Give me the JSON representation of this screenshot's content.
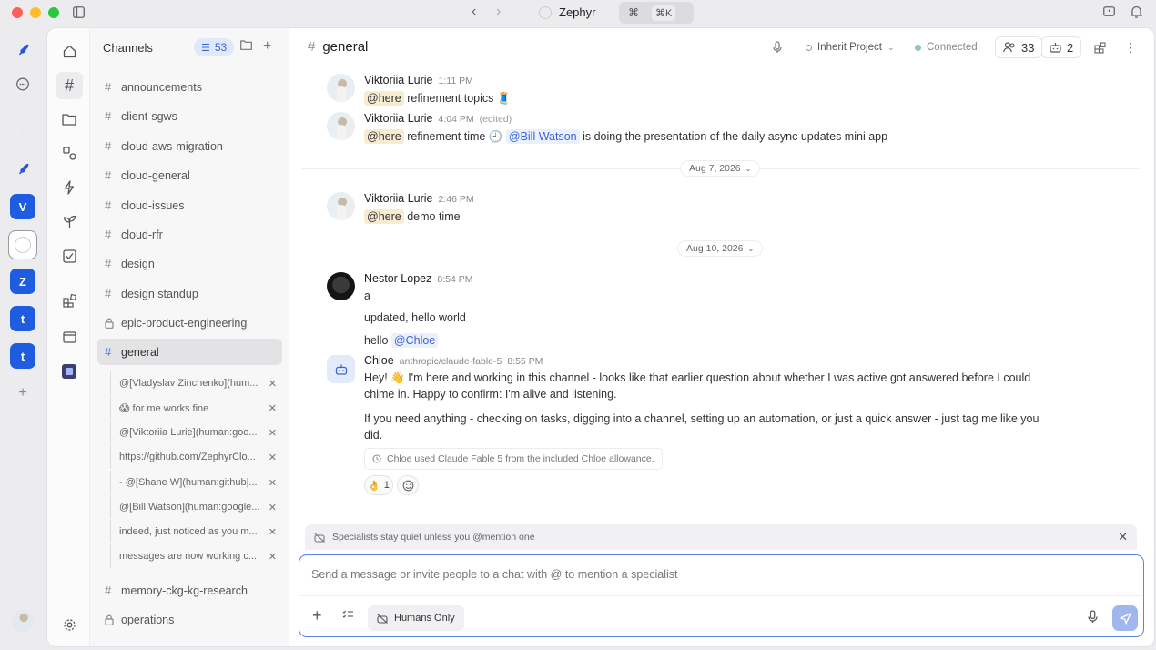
{
  "app": {
    "title": "Zephyr",
    "shortcut": "⌘K"
  },
  "rail": {
    "workspaces": [
      "V",
      "Z",
      "t",
      "t"
    ]
  },
  "sidebar": {
    "title": "Channels",
    "badge_count": "53",
    "channels": [
      {
        "name": "announcements",
        "type": "public"
      },
      {
        "name": "client-sgws",
        "type": "public"
      },
      {
        "name": "cloud-aws-migration",
        "type": "public"
      },
      {
        "name": "cloud-general",
        "type": "public"
      },
      {
        "name": "cloud-issues",
        "type": "public"
      },
      {
        "name": "cloud-rfr",
        "type": "public"
      },
      {
        "name": "design",
        "type": "public"
      },
      {
        "name": "design standup",
        "type": "public"
      },
      {
        "name": "epic-product-engineering",
        "type": "private"
      },
      {
        "name": "general",
        "type": "public",
        "active": true
      }
    ],
    "threads": [
      "@[Vladyslav Zinchenko](hum...",
      "😱 for me works fine",
      "@[Viktoriia Lurie](human:goo...",
      "https://github.com/ZephyrClo...",
      "- @[Shane W](human:github|...",
      "@[Bill Watson](human:google...",
      "indeed, just noticed as you m...",
      "messages are now working c..."
    ],
    "channels_after": [
      {
        "name": "memory-ckg-kg-research",
        "type": "public"
      },
      {
        "name": "operations",
        "type": "private"
      }
    ]
  },
  "header": {
    "channel": "general",
    "project": "Inherit Project",
    "status": "Connected",
    "members": "33",
    "bots": "2"
  },
  "messages": {
    "m1": {
      "author": "Viktoriia Lurie",
      "time": "1:11 PM",
      "mention": "@here",
      "text": "refinement topics 🧵"
    },
    "m2": {
      "author": "Viktoriia Lurie",
      "time": "4:04 PM",
      "edited": "(edited)",
      "mention": "@here",
      "text_a": "refinement time 🕘",
      "user_mention": "@Bill Watson",
      "text_b": "is doing the presentation of the daily async updates mini app"
    },
    "sep1": "Aug 7, 2026",
    "m3": {
      "author": "Viktoriia Lurie",
      "time": "2:46 PM",
      "mention": "@here",
      "text": "demo time"
    },
    "sep2": "Aug 10, 2026",
    "m4": {
      "author": "Nestor Lopez",
      "time": "8:54 PM",
      "line1": "a",
      "line2": "updated, hello world",
      "line3_a": "hello",
      "line3_mention": "@Chloe"
    },
    "m5": {
      "author": "Chloe",
      "model": "anthropic/claude-fable-5",
      "time": "8:55 PM",
      "para1": "Hey! 👋 I'm here and working in this channel - looks like that earlier question about whether I was active got answered before I could chime in. Happy to confirm: I'm alive and listening.",
      "para2": "If you need anything - checking on tasks, digging into a channel, setting up an automation, or just a quick answer - just tag me like you did.",
      "note": "Chloe used Claude Fable 5 from the included Chloe allowance.",
      "reaction_emoji": "👌",
      "reaction_count": "1"
    }
  },
  "banner": {
    "text": "Specialists stay quiet unless you @mention one"
  },
  "composer": {
    "placeholder": "Send a message or invite people to a chat with @ to mention a specialist",
    "mode": "Humans Only"
  },
  "colors": {
    "accent": "#1f5de0",
    "here_bg": "#f7eccf",
    "mention_fg": "#3a63d8",
    "connected": "#8cc9a9"
  }
}
